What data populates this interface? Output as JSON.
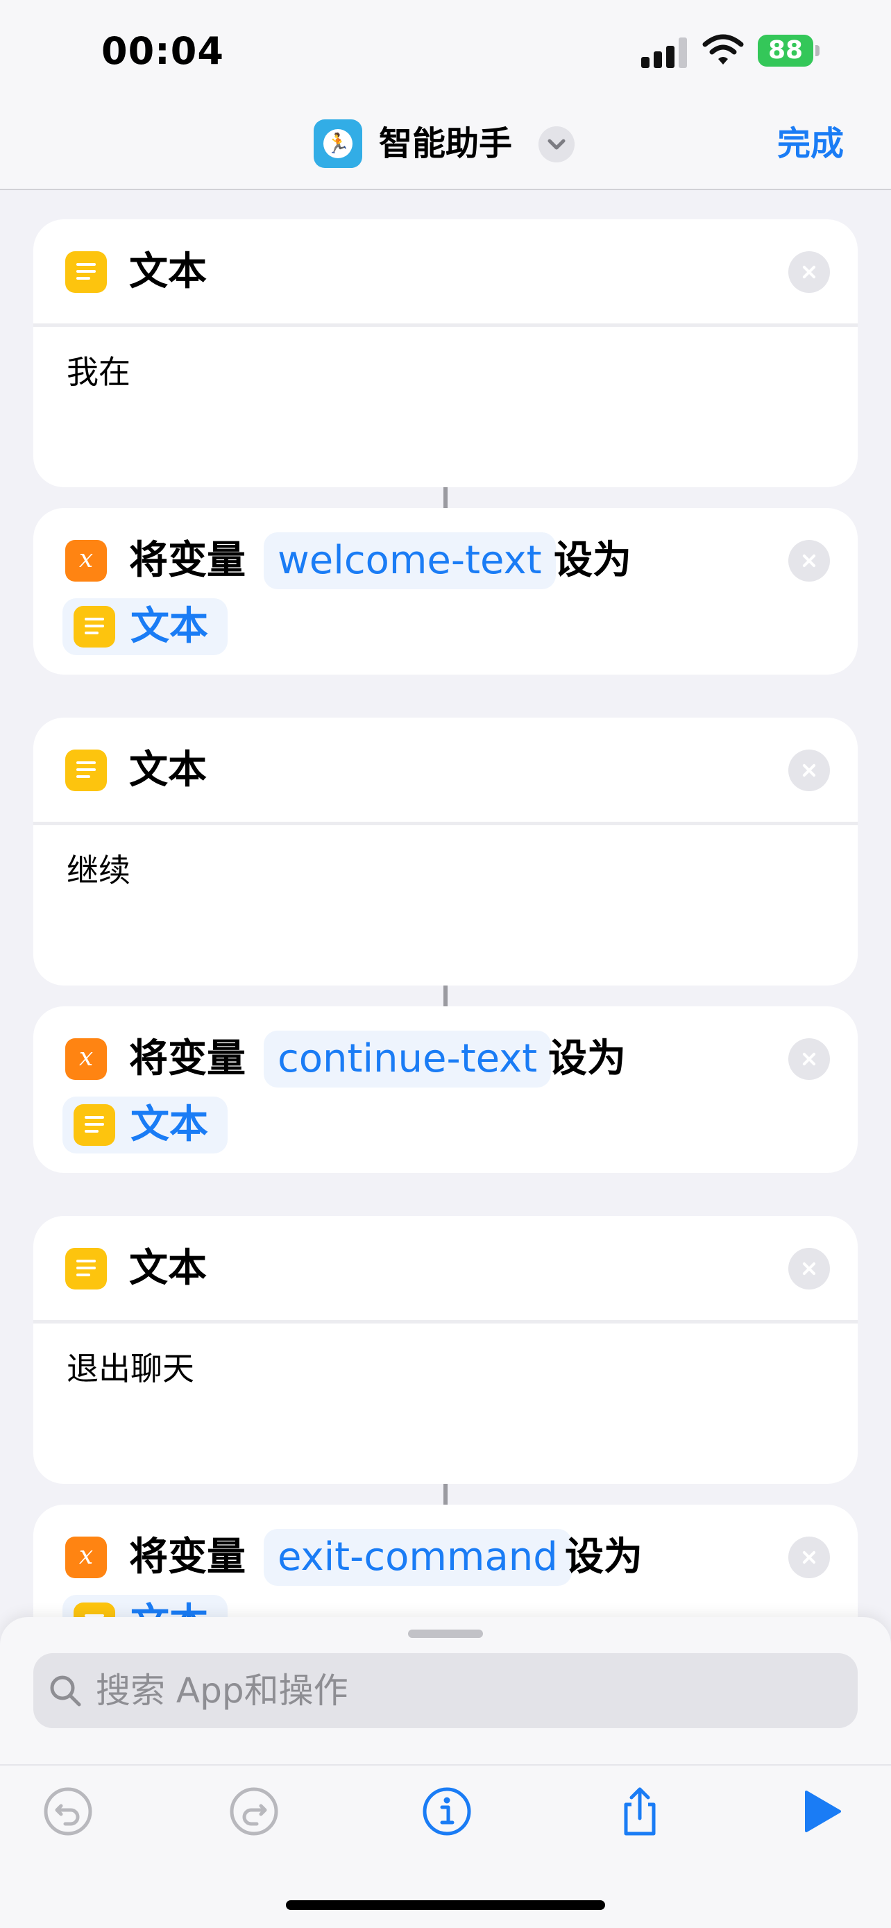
{
  "status_bar": {
    "time": "00:04",
    "battery": "88"
  },
  "nav": {
    "title": "智能助手",
    "done_label": "完成"
  },
  "actions": [
    {
      "type": "text",
      "title": "文本",
      "content": "我在"
    },
    {
      "type": "set_variable",
      "prefix": "将变量",
      "variable": "welcome-text",
      "suffix": "设为",
      "value_label": "文本"
    },
    {
      "type": "text",
      "title": "文本",
      "content": "继续"
    },
    {
      "type": "set_variable",
      "prefix": "将变量",
      "variable": "continue-text",
      "suffix": "设为",
      "value_label": "文本"
    },
    {
      "type": "text",
      "title": "文本",
      "content": "退出聊天"
    },
    {
      "type": "set_variable",
      "prefix": "将变量",
      "variable": "exit-command",
      "suffix": "设为",
      "value_label": "文本"
    }
  ],
  "search": {
    "placeholder": "搜索 App和操作"
  },
  "colors": {
    "accent": "#1a7cf5",
    "text_action": "#fdc40e",
    "variable_action": "#ff8412",
    "app_icon": "#32ade6",
    "battery": "#34c759"
  },
  "icons": {
    "app": "running-figure-icon",
    "text_action": "text-lines-icon",
    "variable_action": "variable-x-icon",
    "toolbar": [
      "undo-icon",
      "redo-icon",
      "info-icon",
      "share-icon",
      "play-icon"
    ]
  }
}
